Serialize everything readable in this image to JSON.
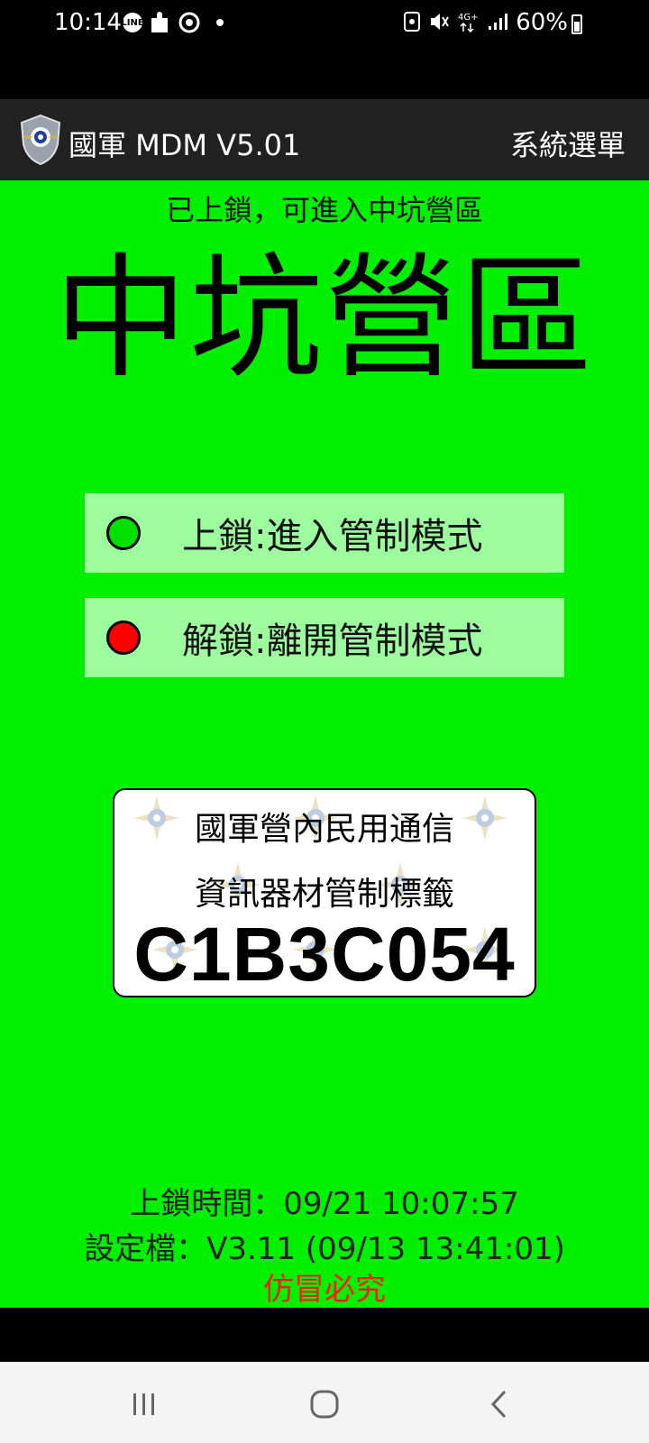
{
  "status_bar": {
    "time": "10:14",
    "battery": "60%",
    "left_icons": [
      "line-icon",
      "puzzle-icon",
      "chrome-icon",
      "dot-icon"
    ],
    "right_icons": [
      "nfc-icon",
      "mute-icon",
      "4g-icon",
      "signal-icon",
      "battery-icon"
    ]
  },
  "app_bar": {
    "title": "國軍 MDM V5.01",
    "menu_label": "系統選單"
  },
  "main": {
    "subtitle": "已上鎖，可進入中坑營區",
    "area_name": "中坑營區",
    "lock_button": {
      "label": "上鎖:進入管制模式",
      "indicator_color": "#00e000"
    },
    "unlock_button": {
      "label": "解鎖:離開管制模式",
      "indicator_color": "#ff0000"
    },
    "label_card": {
      "line1": "國軍營內民用通信",
      "line2": "資訊器材管制標籤",
      "code": "C1B3C054"
    },
    "lock_time": "上鎖時間：09/21 10:07:57",
    "config": "設定檔：V3.11 (09/13 13:41:01)",
    "warning": "仿冒必究"
  },
  "colors": {
    "background": "#00f000",
    "button_bg": "#9dfc9d",
    "app_bar": "#212121",
    "warning": "#ff1a1a"
  },
  "nav_bar": {
    "buttons": [
      "recent-apps-icon",
      "home-icon",
      "back-icon"
    ]
  }
}
